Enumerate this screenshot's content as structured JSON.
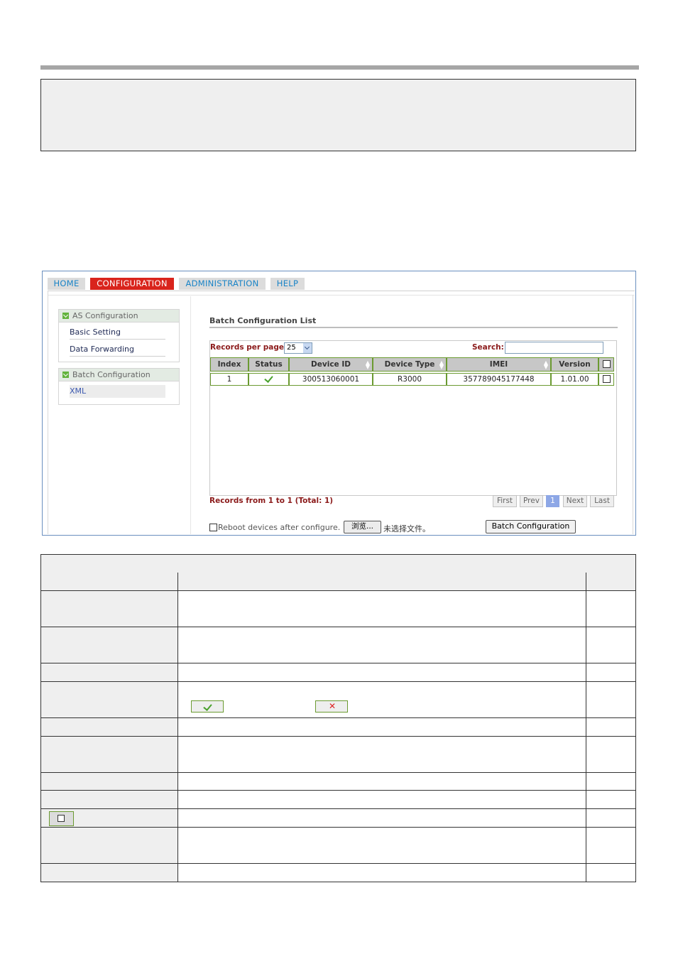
{
  "tabs": [
    "HOME",
    "CONFIGURATION",
    "ADMINISTRATION",
    "HELP"
  ],
  "sidebar": {
    "groups": [
      {
        "title": "AS Configuration",
        "items": [
          "Basic Setting",
          "Data Forwarding"
        ]
      },
      {
        "title": "Batch Configuration",
        "items": [
          "XML"
        ]
      }
    ]
  },
  "list": {
    "title": "Batch Configuration List",
    "records_per_page_label": "Records per page:",
    "records_per_page_value": "25",
    "search_label": "Search:",
    "search_value": "",
    "columns": [
      "Index",
      "Status",
      "Device ID",
      "Device Type",
      "IMEI",
      "Version"
    ],
    "rows": [
      {
        "index": "1",
        "status": "ok",
        "device_id": "300513060001",
        "device_type": "R3000",
        "imei": "357789045177448",
        "version": "1.01.00"
      }
    ],
    "records_text": "Records from 1 to 1 (Total: 1)",
    "pagination": [
      "First",
      "Prev",
      "1",
      "Next",
      "Last"
    ]
  },
  "footer": {
    "reboot_label": "Reboot devices after configure.",
    "browse_label": "浏览...",
    "no_file_label": "未选择文件。",
    "batch_button": "Batch Configuration"
  },
  "colors": {
    "active_tab": "#d9241c",
    "tab_text": "#1a84c7",
    "grid_border": "#6b9a31",
    "label_red": "#8b1a1a"
  }
}
